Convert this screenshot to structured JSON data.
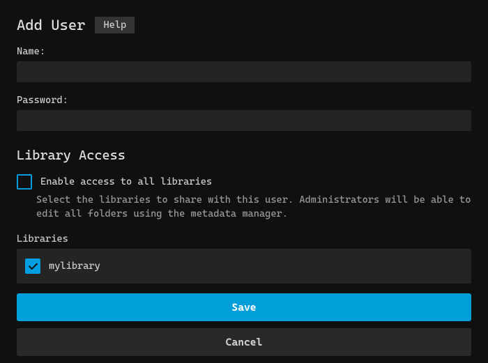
{
  "header": {
    "title": "Add User",
    "help_label": "Help"
  },
  "fields": {
    "name_label": "Name:",
    "name_value": "",
    "password_label": "Password:",
    "password_value": ""
  },
  "library": {
    "section_title": "Library Access",
    "enable_all_label": "Enable access to all libraries",
    "enable_all_checked": false,
    "help_text": "Select the libraries to share with this user. Administrators will be able to edit all folders using the metadata manager.",
    "list_label": "Libraries",
    "items": [
      {
        "name": "mylibrary",
        "checked": true
      }
    ]
  },
  "buttons": {
    "save": "Save",
    "cancel": "Cancel"
  }
}
